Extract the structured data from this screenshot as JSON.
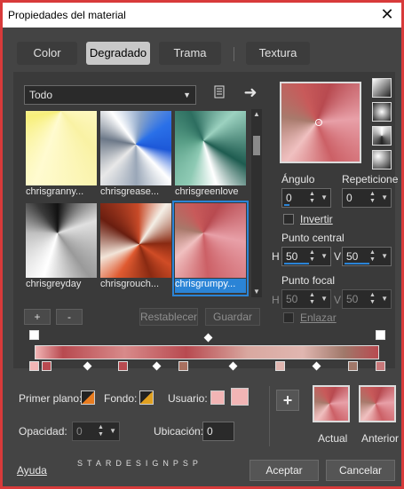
{
  "window": {
    "title": "Propiedades del material",
    "close_glyph": "✕"
  },
  "tabs": [
    {
      "label": "Color",
      "active": false
    },
    {
      "label": "Degradado",
      "active": true
    },
    {
      "label": "Trama",
      "active": false
    },
    {
      "label": "Textura",
      "active": false
    }
  ],
  "library": {
    "category": "Todo",
    "items": [
      {
        "label": "chrisgranny...",
        "selected": false
      },
      {
        "label": "chrisgrease...",
        "selected": false
      },
      {
        "label": "chrisgreenlove",
        "selected": false
      },
      {
        "label": "chrisgreyday",
        "selected": false
      },
      {
        "label": "chrisgrouch...",
        "selected": false
      },
      {
        "label": "chrisgrumpy...",
        "selected": true
      }
    ],
    "add_label": "+",
    "remove_label": "-",
    "reset_label": "Restablecer",
    "save_label": "Guardar"
  },
  "properties": {
    "angle_label": "Ángulo",
    "angle_value": "0",
    "repeats_label": "Repeticione",
    "repeats_value": "0",
    "invert_label": "Invertir",
    "center_label": "Punto central",
    "center_h": "50",
    "center_v": "50",
    "focal_label": "Punto focal",
    "focal_h": "50",
    "focal_v": "50",
    "link_label": "Enlazar",
    "h_label": "H",
    "v_label": "V"
  },
  "colors": {
    "foreground_label": "Primer plano:",
    "background_label": "Fondo:",
    "user_label": "Usuario:",
    "opacity_label": "Opacidad:",
    "opacity_value": "0",
    "location_label": "Ubicación:",
    "location_value": "0",
    "user_color": "#f2b5b5"
  },
  "compare": {
    "add_label": "+",
    "current_label": "Actual",
    "previous_label": "Anterior"
  },
  "footer": {
    "help_label": "Ayuda",
    "watermark": "STARDESIGNPSP",
    "ok_label": "Aceptar",
    "cancel_label": "Cancelar"
  }
}
